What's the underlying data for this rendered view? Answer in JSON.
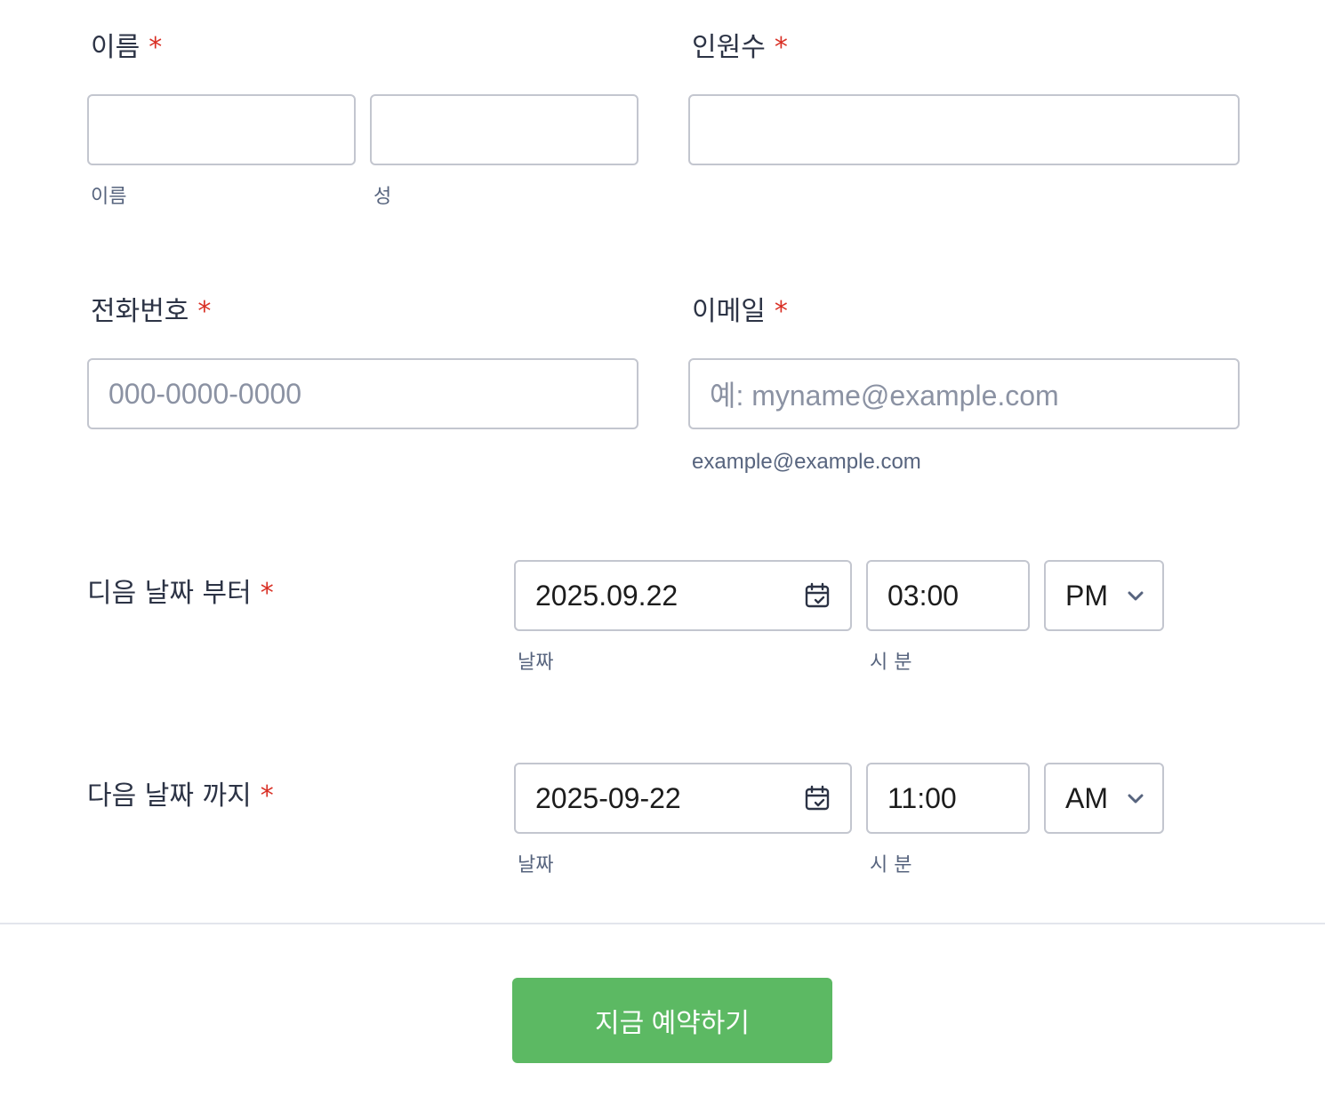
{
  "name_field": {
    "label": "이름",
    "required_mark": "*",
    "first_value": "",
    "last_value": "",
    "first_sublabel": "이름",
    "last_sublabel": "성"
  },
  "guests_field": {
    "label": "인원수",
    "required_mark": "*",
    "value": ""
  },
  "phone_field": {
    "label": "전화번호",
    "required_mark": "*",
    "placeholder": "000-0000-0000"
  },
  "email_field": {
    "label": "이메일",
    "required_mark": "*",
    "placeholder": "예: myname@example.com",
    "hint": "example@example.com"
  },
  "from_field": {
    "label": "디음 날짜 부터",
    "required_mark": "*",
    "date_value": "2025.09.22",
    "time_value": "03:00",
    "ampm_value": "PM",
    "date_sublabel": "날짜",
    "time_sublabel": "시 분",
    "date_icon": "calendar-icon",
    "ampm_icon": "chevron-down-icon"
  },
  "to_field": {
    "label": "다음 날짜 까지",
    "required_mark": "*",
    "date_value": "2025-09-22",
    "time_value": "11:00",
    "ampm_value": "AM",
    "date_sublabel": "날짜",
    "time_sublabel": "시 분",
    "date_icon": "calendar-icon",
    "ampm_icon": "chevron-down-icon"
  },
  "submit": {
    "label": "지금 예약하기",
    "color": "#5cb963"
  },
  "colors": {
    "required": "#d93025",
    "border": "#c3c6cf",
    "label_text": "#2c3345",
    "sublabel_text": "#57647e",
    "placeholder_text": "#8b92a3"
  }
}
